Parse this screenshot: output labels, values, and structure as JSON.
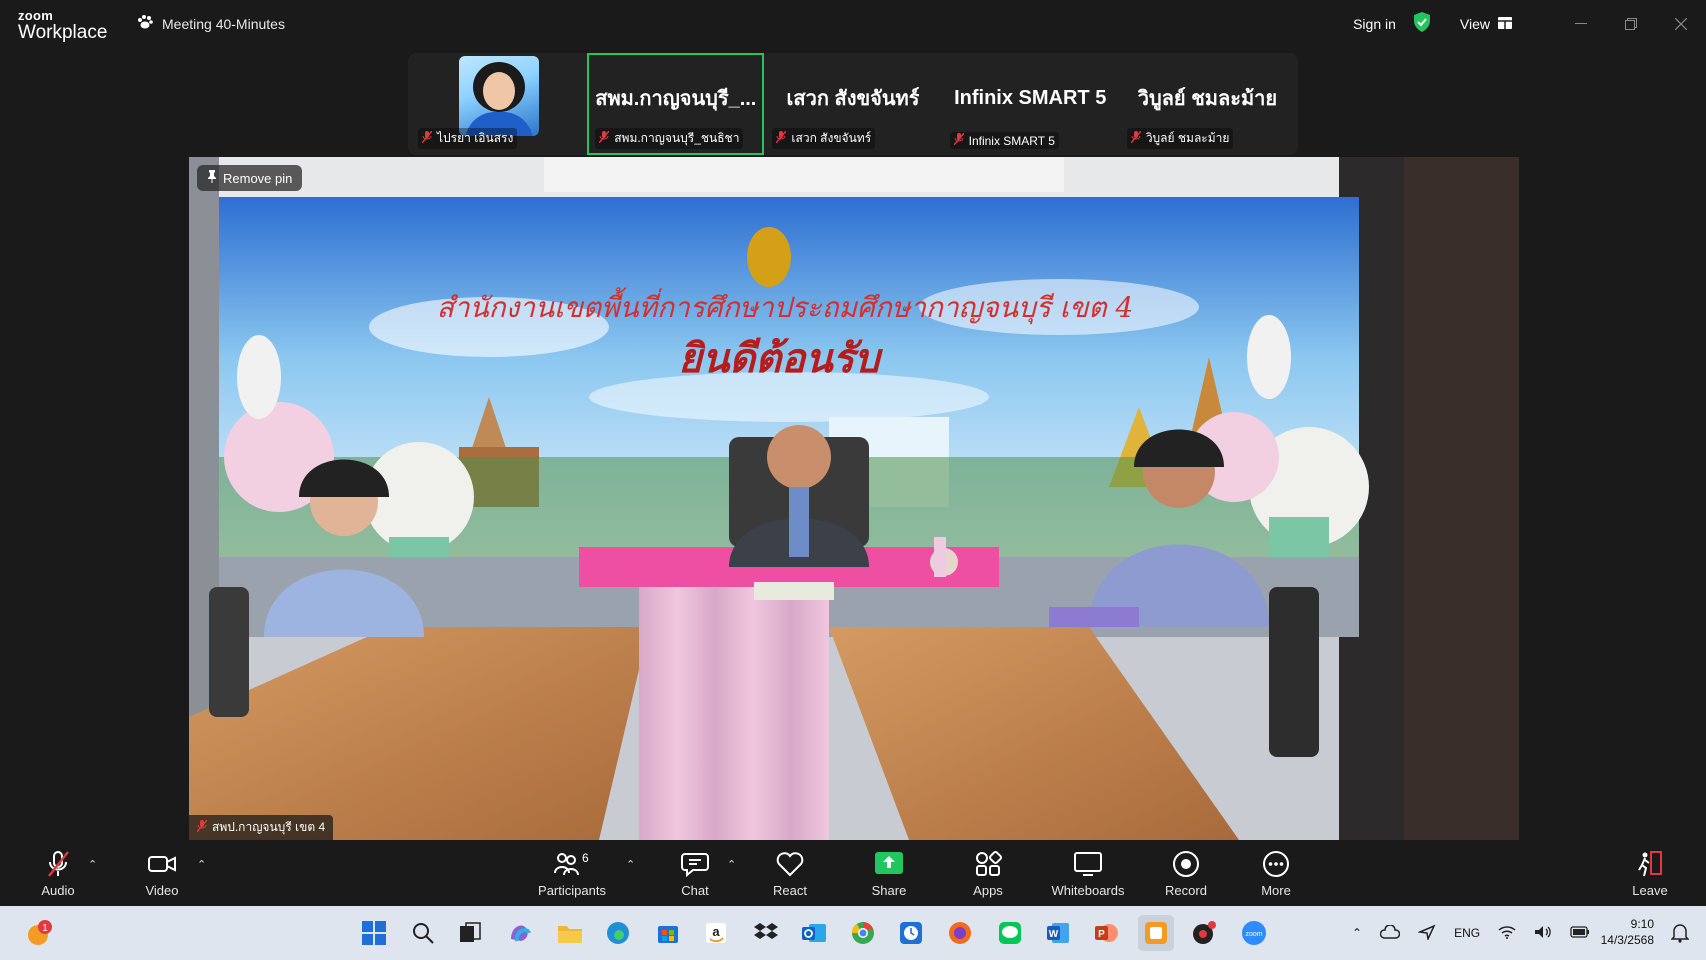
{
  "titlebar": {
    "brand_top": "zoom",
    "brand_bottom": "Workplace",
    "meeting_title": "Meeting 40-Minutes",
    "signin": "Sign in",
    "view": "View"
  },
  "thumbnails": [
    {
      "big": "",
      "tag": "ไปรยา เอินสรง",
      "has_photo": true
    },
    {
      "big": "สพม.กาญจนบุรี_...",
      "tag": "สพม.กาญจนบุรี_ชนธิชา",
      "active": true
    },
    {
      "big": "เสวก  สังขจันทร์",
      "tag": "เสวก  สังขจันทร์"
    },
    {
      "big": "Infinix SMART 5",
      "tag": "Infinix SMART 5"
    },
    {
      "big": "วิบูลย์  ชมละม้าย",
      "tag": "วิบูลย์  ชมละม้าย"
    }
  ],
  "video": {
    "remove_pin": "Remove pin",
    "speaker_label": "สพป.กาญจนบุรี เขต 4",
    "banner_line1": "สำนักงานเขตพื้นที่การศึกษาประถมศึกษากาญจนบุรี เขต 4",
    "banner_line2": "ยินดีต้อนรับ"
  },
  "toolbar": {
    "audio": "Audio",
    "video": "Video",
    "participants": "Participants",
    "participants_count": "6",
    "chat": "Chat",
    "react": "React",
    "share": "Share",
    "apps": "Apps",
    "whiteboards": "Whiteboards",
    "record": "Record",
    "more": "More",
    "leave": "Leave"
  },
  "taskbar": {
    "notification_count": "1",
    "language": "ENG",
    "time": "9:10",
    "date": "14/3/2568"
  },
  "colors": {
    "active_border": "#22c55e",
    "share_green": "#22c55e",
    "mute_red": "#e0393e",
    "leave_red": "#e0393e"
  }
}
